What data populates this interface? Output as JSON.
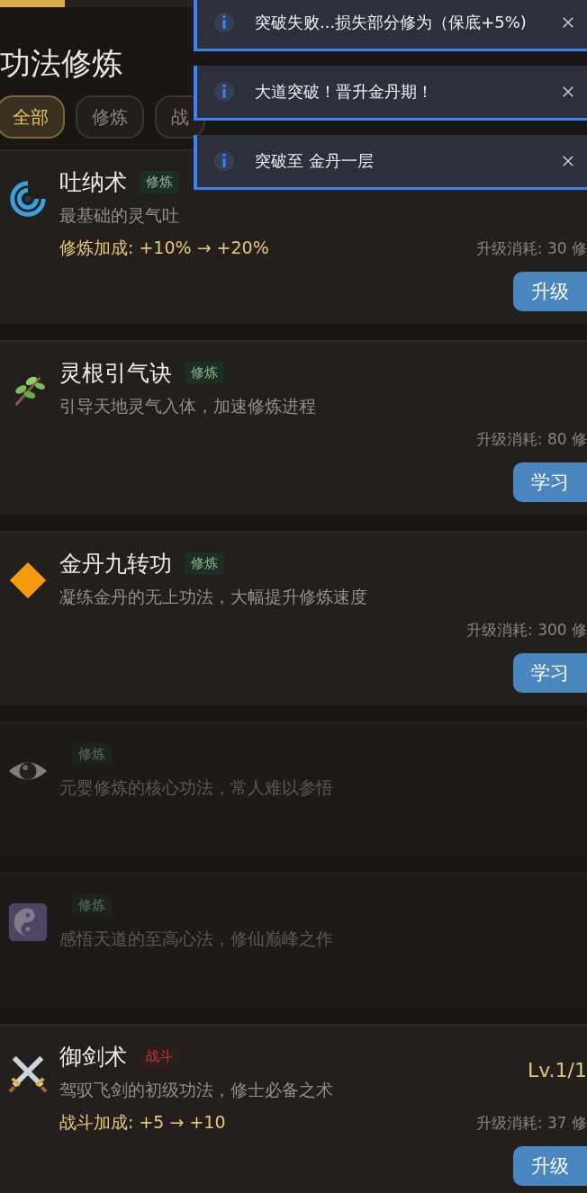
{
  "title": "功法修炼",
  "tabs": [
    {
      "label": "全部",
      "selected": true
    },
    {
      "label": "修炼",
      "selected": false
    },
    {
      "label": "战",
      "selected": false
    }
  ],
  "skills": [
    {
      "name": "吐纳术",
      "tag": {
        "label": "修炼",
        "kind": "cultivate"
      },
      "description": "最基础的灵气吐",
      "bonus": "修炼加成: +10% → +20%",
      "cost": "升级消耗: 30 修",
      "button": "升级",
      "locked": false
    },
    {
      "name": "灵根引气诀",
      "tag": {
        "label": "修炼",
        "kind": "cultivate"
      },
      "description": "引导天地灵气入体，加速修炼进程",
      "cost": "升级消耗: 80 修",
      "button": "学习",
      "locked": false
    },
    {
      "name": "金丹九转功",
      "tag": {
        "label": "修炼",
        "kind": "cultivate"
      },
      "description": "凝练金丹的无上功法，大幅提升修炼速度",
      "cost": "升级消耗: 300 修",
      "button": "学习",
      "locked": false
    },
    {
      "tag": {
        "label": "修炼",
        "kind": "cultivate"
      },
      "description": "元婴修炼的核心功法，常人难以参悟",
      "locked": true
    },
    {
      "tag": {
        "label": "修炼",
        "kind": "cultivate"
      },
      "description": "感悟天道的至高心法，修仙巅峰之作",
      "locked": true
    },
    {
      "name": "御剑术",
      "tag": {
        "label": "战斗",
        "kind": "combat"
      },
      "level": "Lv.1/1",
      "description": "驾驭飞剑的初级功法，修士必备之术",
      "bonus": "战斗加成: +5 → +10",
      "cost": "升级消耗: 37 修",
      "button": "升级",
      "locked": false
    }
  ],
  "toasts": [
    {
      "message": "突破失败...损失部分修为（保底+5%)"
    },
    {
      "message": "大道突破！晋升金丹期！"
    },
    {
      "message": "突破至 金丹一层"
    }
  ]
}
